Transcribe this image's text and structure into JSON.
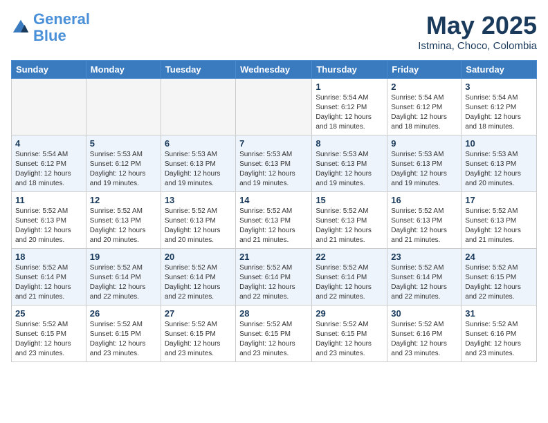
{
  "header": {
    "logo_line1": "General",
    "logo_line2": "Blue",
    "month": "May 2025",
    "location": "Istmina, Choco, Colombia"
  },
  "weekdays": [
    "Sunday",
    "Monday",
    "Tuesday",
    "Wednesday",
    "Thursday",
    "Friday",
    "Saturday"
  ],
  "weeks": [
    [
      {
        "day": "",
        "info": ""
      },
      {
        "day": "",
        "info": ""
      },
      {
        "day": "",
        "info": ""
      },
      {
        "day": "",
        "info": ""
      },
      {
        "day": "1",
        "info": "Sunrise: 5:54 AM\nSunset: 6:12 PM\nDaylight: 12 hours\nand 18 minutes."
      },
      {
        "day": "2",
        "info": "Sunrise: 5:54 AM\nSunset: 6:12 PM\nDaylight: 12 hours\nand 18 minutes."
      },
      {
        "day": "3",
        "info": "Sunrise: 5:54 AM\nSunset: 6:12 PM\nDaylight: 12 hours\nand 18 minutes."
      }
    ],
    [
      {
        "day": "4",
        "info": "Sunrise: 5:54 AM\nSunset: 6:12 PM\nDaylight: 12 hours\nand 18 minutes."
      },
      {
        "day": "5",
        "info": "Sunrise: 5:53 AM\nSunset: 6:12 PM\nDaylight: 12 hours\nand 19 minutes."
      },
      {
        "day": "6",
        "info": "Sunrise: 5:53 AM\nSunset: 6:13 PM\nDaylight: 12 hours\nand 19 minutes."
      },
      {
        "day": "7",
        "info": "Sunrise: 5:53 AM\nSunset: 6:13 PM\nDaylight: 12 hours\nand 19 minutes."
      },
      {
        "day": "8",
        "info": "Sunrise: 5:53 AM\nSunset: 6:13 PM\nDaylight: 12 hours\nand 19 minutes."
      },
      {
        "day": "9",
        "info": "Sunrise: 5:53 AM\nSunset: 6:13 PM\nDaylight: 12 hours\nand 19 minutes."
      },
      {
        "day": "10",
        "info": "Sunrise: 5:53 AM\nSunset: 6:13 PM\nDaylight: 12 hours\nand 20 minutes."
      }
    ],
    [
      {
        "day": "11",
        "info": "Sunrise: 5:52 AM\nSunset: 6:13 PM\nDaylight: 12 hours\nand 20 minutes."
      },
      {
        "day": "12",
        "info": "Sunrise: 5:52 AM\nSunset: 6:13 PM\nDaylight: 12 hours\nand 20 minutes."
      },
      {
        "day": "13",
        "info": "Sunrise: 5:52 AM\nSunset: 6:13 PM\nDaylight: 12 hours\nand 20 minutes."
      },
      {
        "day": "14",
        "info": "Sunrise: 5:52 AM\nSunset: 6:13 PM\nDaylight: 12 hours\nand 21 minutes."
      },
      {
        "day": "15",
        "info": "Sunrise: 5:52 AM\nSunset: 6:13 PM\nDaylight: 12 hours\nand 21 minutes."
      },
      {
        "day": "16",
        "info": "Sunrise: 5:52 AM\nSunset: 6:13 PM\nDaylight: 12 hours\nand 21 minutes."
      },
      {
        "day": "17",
        "info": "Sunrise: 5:52 AM\nSunset: 6:13 PM\nDaylight: 12 hours\nand 21 minutes."
      }
    ],
    [
      {
        "day": "18",
        "info": "Sunrise: 5:52 AM\nSunset: 6:14 PM\nDaylight: 12 hours\nand 21 minutes."
      },
      {
        "day": "19",
        "info": "Sunrise: 5:52 AM\nSunset: 6:14 PM\nDaylight: 12 hours\nand 22 minutes."
      },
      {
        "day": "20",
        "info": "Sunrise: 5:52 AM\nSunset: 6:14 PM\nDaylight: 12 hours\nand 22 minutes."
      },
      {
        "day": "21",
        "info": "Sunrise: 5:52 AM\nSunset: 6:14 PM\nDaylight: 12 hours\nand 22 minutes."
      },
      {
        "day": "22",
        "info": "Sunrise: 5:52 AM\nSunset: 6:14 PM\nDaylight: 12 hours\nand 22 minutes."
      },
      {
        "day": "23",
        "info": "Sunrise: 5:52 AM\nSunset: 6:14 PM\nDaylight: 12 hours\nand 22 minutes."
      },
      {
        "day": "24",
        "info": "Sunrise: 5:52 AM\nSunset: 6:15 PM\nDaylight: 12 hours\nand 22 minutes."
      }
    ],
    [
      {
        "day": "25",
        "info": "Sunrise: 5:52 AM\nSunset: 6:15 PM\nDaylight: 12 hours\nand 23 minutes."
      },
      {
        "day": "26",
        "info": "Sunrise: 5:52 AM\nSunset: 6:15 PM\nDaylight: 12 hours\nand 23 minutes."
      },
      {
        "day": "27",
        "info": "Sunrise: 5:52 AM\nSunset: 6:15 PM\nDaylight: 12 hours\nand 23 minutes."
      },
      {
        "day": "28",
        "info": "Sunrise: 5:52 AM\nSunset: 6:15 PM\nDaylight: 12 hours\nand 23 minutes."
      },
      {
        "day": "29",
        "info": "Sunrise: 5:52 AM\nSunset: 6:15 PM\nDaylight: 12 hours\nand 23 minutes."
      },
      {
        "day": "30",
        "info": "Sunrise: 5:52 AM\nSunset: 6:16 PM\nDaylight: 12 hours\nand 23 minutes."
      },
      {
        "day": "31",
        "info": "Sunrise: 5:52 AM\nSunset: 6:16 PM\nDaylight: 12 hours\nand 23 minutes."
      }
    ]
  ]
}
